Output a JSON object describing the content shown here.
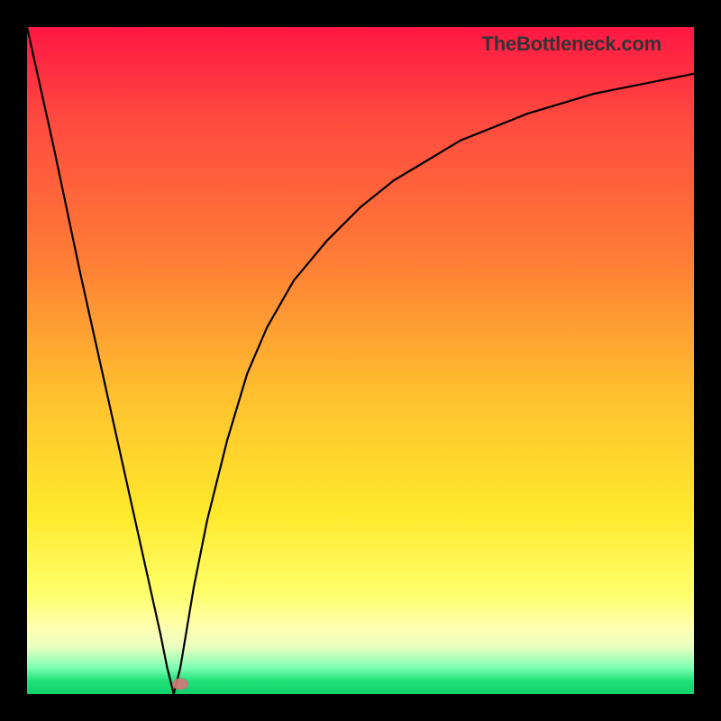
{
  "branding": {
    "text": "TheBottleneck.com"
  },
  "chart_data": {
    "type": "line",
    "title": "",
    "xlabel": "",
    "ylabel": "",
    "xlim": [
      0,
      100
    ],
    "ylim": [
      0,
      100
    ],
    "background": "rainbow-gradient",
    "series": [
      {
        "name": "left-branch",
        "x": [
          0,
          4,
          8,
          12,
          14,
          16,
          18,
          20,
          21,
          22
        ],
        "values": [
          100,
          82,
          63,
          45,
          36,
          27,
          18,
          9,
          4,
          0
        ]
      },
      {
        "name": "right-branch",
        "x": [
          22,
          23,
          24,
          25,
          27,
          30,
          33,
          36,
          40,
          45,
          50,
          55,
          60,
          65,
          70,
          75,
          80,
          85,
          90,
          95,
          100
        ],
        "values": [
          0,
          4,
          10,
          16,
          26,
          38,
          48,
          55,
          62,
          68,
          73,
          77,
          80,
          83,
          85,
          87,
          88.5,
          90,
          91,
          92,
          93
        ]
      }
    ],
    "marker": {
      "x": 23,
      "y": 1.5
    },
    "annotations": []
  }
}
